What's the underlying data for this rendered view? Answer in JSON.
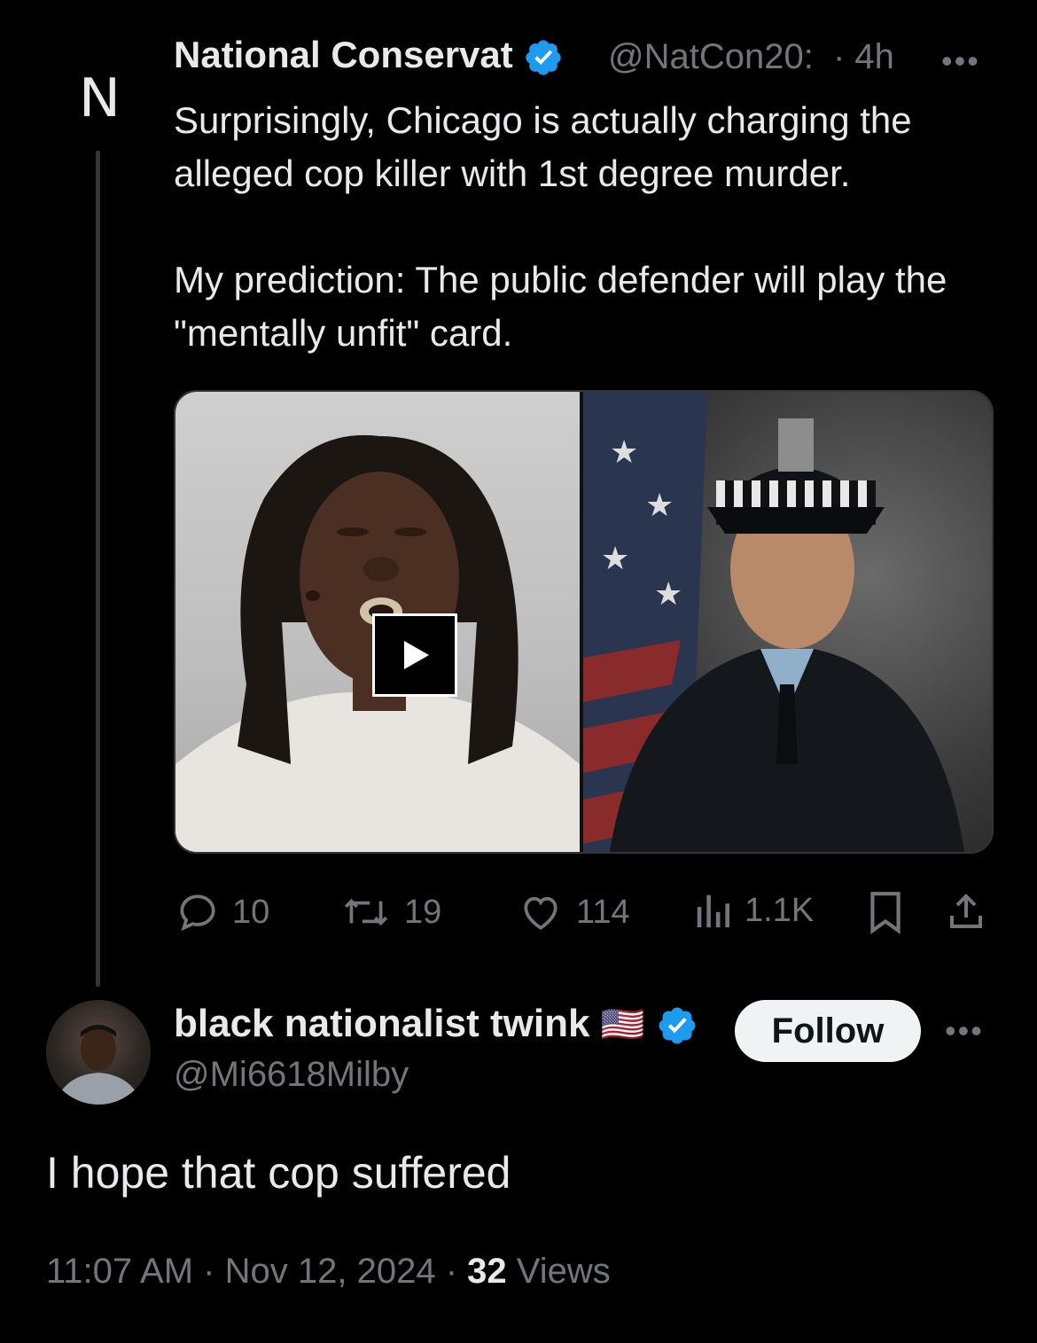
{
  "original_tweet": {
    "avatar_letter": "N",
    "display_name": "National Conservat",
    "handle": "@NatCon20:",
    "time": "· 4h",
    "more": "•••",
    "text_p1": "Surprisingly, Chicago is actually charging the alleged cop killer with 1st degree murder.",
    "text_p2": "My prediction: The public defender will play the \"mentally unfit\" card.",
    "media": {
      "left_image": "mugshot-photo",
      "right_image": "police-officer-portrait",
      "play_icon": "play-icon"
    },
    "actions": {
      "replies": "10",
      "reposts": "19",
      "likes": "114",
      "views": "1.1K"
    }
  },
  "reply": {
    "display_name": "black nationalist twink",
    "flag": "🇺🇸",
    "handle": "@Mi6618Milby",
    "follow_label": "Follow",
    "more": "•••",
    "text": "I hope that cop suffered",
    "time": "11:07 AM",
    "date": "Nov 12, 2024",
    "views_count": "32",
    "views_label": "Views"
  },
  "colors": {
    "background": "#000000",
    "text": "#e7e9ea",
    "muted": "#71767b",
    "verified": "#1d9bf0",
    "border": "#333639"
  }
}
